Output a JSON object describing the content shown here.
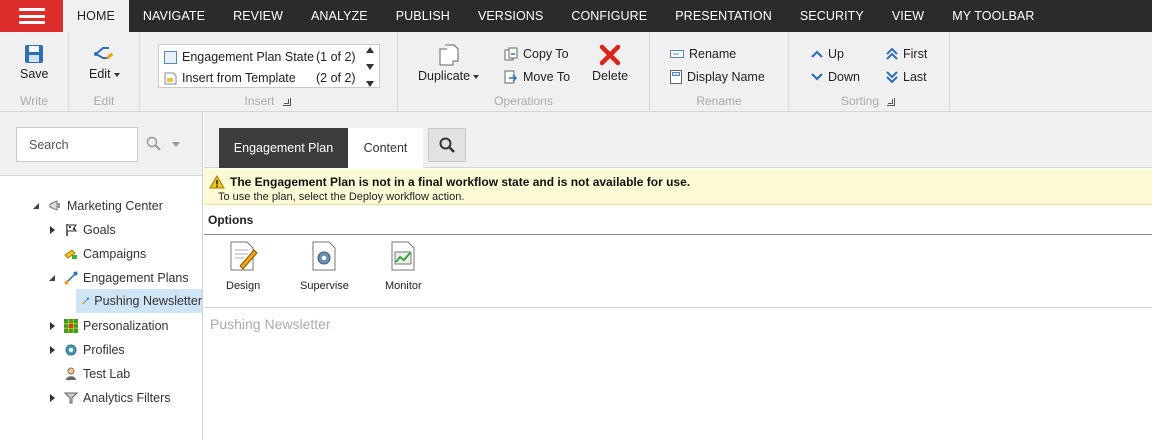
{
  "topbar": {
    "menu": [
      "HOME",
      "NAVIGATE",
      "REVIEW",
      "ANALYZE",
      "PUBLISH",
      "VERSIONS",
      "CONFIGURE",
      "PRESENTATION",
      "SECURITY",
      "VIEW",
      "MY TOOLBAR"
    ],
    "active_index": 0
  },
  "ribbon": {
    "write": {
      "save": "Save",
      "label": "Write"
    },
    "edit": {
      "edit": "Edit",
      "label": "Edit"
    },
    "insert": {
      "items": [
        {
          "name": "Engagement Plan State",
          "count": "(1 of 2)"
        },
        {
          "name": "Insert from Template",
          "count": "(2 of 2)"
        }
      ],
      "label": "Insert"
    },
    "operations": {
      "duplicate": "Duplicate",
      "copy_to": "Copy To",
      "move_to": "Move To",
      "delete": "Delete",
      "label": "Operations"
    },
    "rename": {
      "rename": "Rename",
      "display_name": "Display Name",
      "label": "Rename"
    },
    "sorting": {
      "up": "Up",
      "down": "Down",
      "first": "First",
      "last": "Last",
      "label": "Sorting"
    }
  },
  "sidebar": {
    "search_placeholder": "Search",
    "tree": [
      {
        "label": "Marketing Center",
        "icon": "marketing-center-icon"
      },
      {
        "label": "Goals",
        "icon": "flag-icon"
      },
      {
        "label": "Campaigns",
        "icon": "campaigns-icon"
      },
      {
        "label": "Engagement Plans",
        "icon": "engagement-plan-icon"
      },
      {
        "label": "Pushing Newsletter",
        "icon": "engagement-plan-icon"
      },
      {
        "label": "Personalization",
        "icon": "grid-icon"
      },
      {
        "label": "Profiles",
        "icon": "gear-icon"
      },
      {
        "label": "Test Lab",
        "icon": "user-icon"
      },
      {
        "label": "Analytics Filters",
        "icon": "funnel-icon"
      }
    ]
  },
  "content": {
    "tabs": [
      "Engagement Plan",
      "Content"
    ],
    "warning": {
      "title": "The Engagement Plan is not in a final workflow state and is not available for use.",
      "subtitle": "To use the plan, select the Deploy workflow action."
    },
    "options_label": "Options",
    "options": [
      "Design",
      "Supervise",
      "Monitor"
    ],
    "item_title": "Pushing Newsletter"
  },
  "colors": {
    "accent": "#dc2c2c",
    "topbar": "#2b2b2b",
    "ribbon": "#f0f0f0",
    "selected": "#cfe4f5",
    "warning_bg": "#fdfbd6"
  }
}
